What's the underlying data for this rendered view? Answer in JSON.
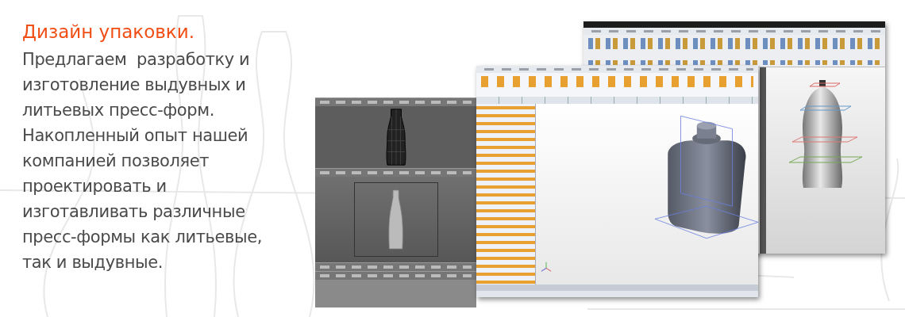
{
  "headline": "Дизайн упаковки.",
  "description": "Предлагаем  разработку и изготовление выдувных и литьевых пресс-форм. Накопленный опыт нашей компанией позволяет проектировать и изготавливать различные пресс-формы как литьевые, так и выдувные."
}
